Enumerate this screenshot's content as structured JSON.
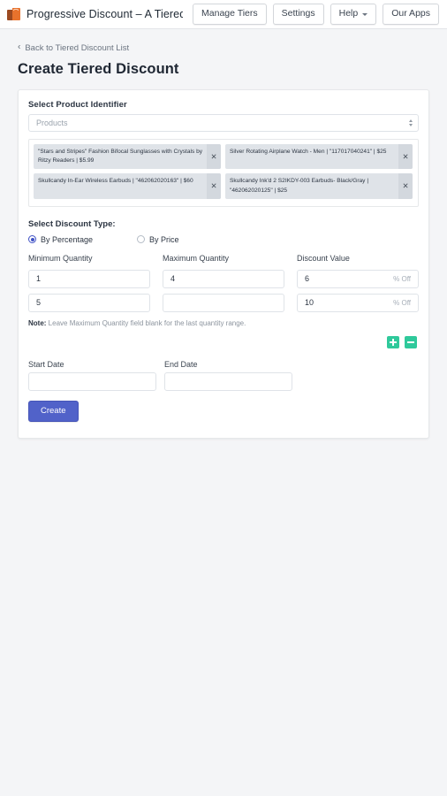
{
  "appbar": {
    "logo_icon": "shopping-bag-icon",
    "title": "Progressive Discount – A Tiered Discount app...",
    "actions": [
      {
        "label": "Manage Tiers",
        "name": "manage-tiers-button",
        "caret": false
      },
      {
        "label": "Settings",
        "name": "settings-button",
        "caret": false
      },
      {
        "label": "Help",
        "name": "help-button",
        "caret": true
      },
      {
        "label": "Our Apps",
        "name": "our-apps-button",
        "caret": false
      }
    ]
  },
  "page": {
    "back_chevron": "‹",
    "back_label": "Back to Tiered Discount List",
    "title": "Create Tiered Discount"
  },
  "product_identifier": {
    "label": "Select Product Identifier",
    "select_placeholder": "Products",
    "select_value": "",
    "spinner_icon": "up-down-arrows-icon",
    "tags": [
      {
        "text": "\"Stars and Stripes\" Fashion Bifocal Sunglasses with Crystals by Ritzy Readers | $5.99",
        "remove_icon": "close-icon"
      },
      {
        "text": "Silver Rotating Airplane Watch - Men | \"117017040241\" | $25",
        "remove_icon": "close-icon"
      },
      {
        "text": "Skullcandy In-Ear Wireless Earbuds | \"462062020163\" | $60",
        "remove_icon": "close-icon"
      },
      {
        "text": "Skullcandy Ink'd 2 S2IKDY-003 Earbuds- Black/Gray | \"462062020125\" | $25",
        "remove_icon": "close-icon"
      }
    ]
  },
  "discount_type": {
    "label": "Select Discount Type:",
    "options": [
      {
        "label": "By Percentage",
        "selected": true
      },
      {
        "label": "By Price",
        "selected": false
      }
    ]
  },
  "tiers": {
    "headers": {
      "min": "Minimum Quantity",
      "max": "Maximum Quantity",
      "value": "Discount Value"
    },
    "rows": [
      {
        "min": "1",
        "max": "4",
        "value": "6",
        "suffix": "% Off"
      },
      {
        "min": "5",
        "max": "",
        "value": "10",
        "suffix": "% Off"
      }
    ],
    "note_prefix": "Note:",
    "note_text": " Leave Maximum Quantity field blank for the last quantity range.",
    "add_row_icon": "plus-icon",
    "remove_row_icon": "minus-icon",
    "add_row_color": "#2fc99b"
  },
  "dates": {
    "start_label": "Start Date",
    "start_value": "",
    "end_label": "End Date",
    "end_value": ""
  },
  "submit": {
    "label": "Create",
    "color": "#5162c9"
  }
}
